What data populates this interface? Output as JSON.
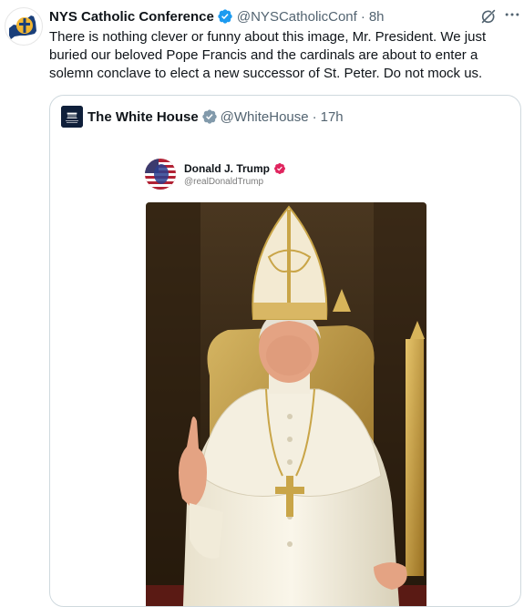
{
  "tweet": {
    "author_name": "NYS Catholic Conference",
    "handle": "@NYSCatholicConf",
    "separator": "·",
    "time": "8h",
    "text": "There is nothing clever or funny about this image, Mr. President. We just buried our beloved Pope Francis and the cardinals are about to enter a solemn conclave to elect a new successor of St. Peter. Do not mock us."
  },
  "quoted_tweet": {
    "author_name": "The White House",
    "handle": "@WhiteHouse",
    "separator": "·",
    "time": "17h",
    "avatar_text": "THE WHITE HOUSE"
  },
  "embedded_post": {
    "name": "Donald J. Trump",
    "handle": "@realDonaldTrump"
  },
  "icons": {
    "verified": "verified-badge-icon",
    "grok": "grok-icon",
    "more": "more-options-icon"
  },
  "colors": {
    "verified_blue": "#1d9bf0",
    "verified_gray": "#829aab",
    "verified_red": "#e0245e",
    "text_primary": "#0f1419",
    "text_secondary": "#536471",
    "border": "#cfd9de"
  }
}
